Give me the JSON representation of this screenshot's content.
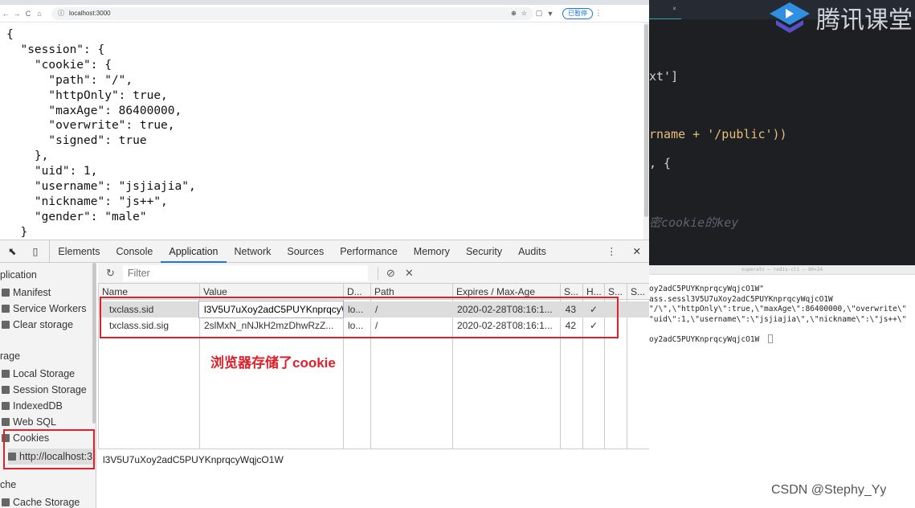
{
  "browser": {
    "url": "localhost:3000",
    "paused_label": "已暂停",
    "json_lines": [
      "{",
      "  \"session\": {",
      "    \"cookie\": {",
      "      \"path\": \"/\",",
      "      \"httpOnly\": true,",
      "      \"maxAge\": 86400000,",
      "      \"overwrite\": true,",
      "      \"signed\": true",
      "    },",
      "    \"uid\": 1,",
      "    \"username\": \"jsjiajia\",",
      "    \"nickname\": \"js++\",",
      "    \"gender\": \"male\"",
      "  }"
    ]
  },
  "devtools": {
    "tabs": [
      "Elements",
      "Console",
      "Application",
      "Network",
      "Sources",
      "Performance",
      "Memory",
      "Security",
      "Audits"
    ],
    "active_tab": "Application",
    "filter_placeholder": "Filter",
    "sidebar": {
      "application_header": "plication",
      "app_items": [
        "Manifest",
        "Service Workers",
        "Clear storage"
      ],
      "storage_header": "rage",
      "storage_items": [
        "Local Storage",
        "Session Storage",
        "IndexedDB",
        "Web SQL",
        "Cookies"
      ],
      "cookie_origin": "http://localhost:3",
      "cache_header": "che",
      "cache_items": [
        "Cache Storage"
      ]
    },
    "columns": [
      "Name",
      "Value",
      "D...",
      "Path",
      "Expires / Max-Age",
      "S...",
      "H...",
      "S...",
      "S..."
    ],
    "rows": [
      [
        "txclass.sid",
        "l3V5U7uXoy2adC5PUYKnprqcyWqjcO1W",
        "lo...",
        "/",
        "2020-02-28T08:16:1...",
        "43",
        "✓",
        "",
        ""
      ],
      [
        "txclass.sid.sig",
        "2slMxN_nNJkH2mzDhwRzZ...",
        "lo...",
        "/",
        "2020-02-28T08:16:1...",
        "42",
        "✓",
        "",
        ""
      ]
    ],
    "preview_value": "l3V5U7uXoy2adC5PUYKnprqcyWqjcO1W"
  },
  "annotation": "浏览器存储了cookie",
  "editor": {
    "logo_text": "腾讯课堂",
    "lines": [
      "xt']",
      "rname + '/public'))",
      ", {",
      "密cookie的key"
    ]
  },
  "terminal": {
    "title": "superatc — redis-cli — 80×24",
    "lines": [
      "oy2adC5PUYKnprqcyWqjcO1W\"",
      "ass.sessl3V5U7uXoy2adC5PUYKnprqcyWqjcO1W",
      "\"/\\\",\\\"httpOnly\\\":true,\\\"maxAge\\\":86400000,\\\"overwrite\\\"",
      "\"uid\\\":1,\\\"username\\\":\\\"jsjiajia\\\",\\\"nickname\\\":\\\"js++\\\"",
      "",
      "oy2adC5PUYKnprqcyWqjcO1W"
    ]
  },
  "watermark": "CSDN @Stephy_Yy",
  "colors": {
    "accent": "#1a73e8",
    "highlight": "#e0202a",
    "editor_bg": "#1e1f22"
  }
}
